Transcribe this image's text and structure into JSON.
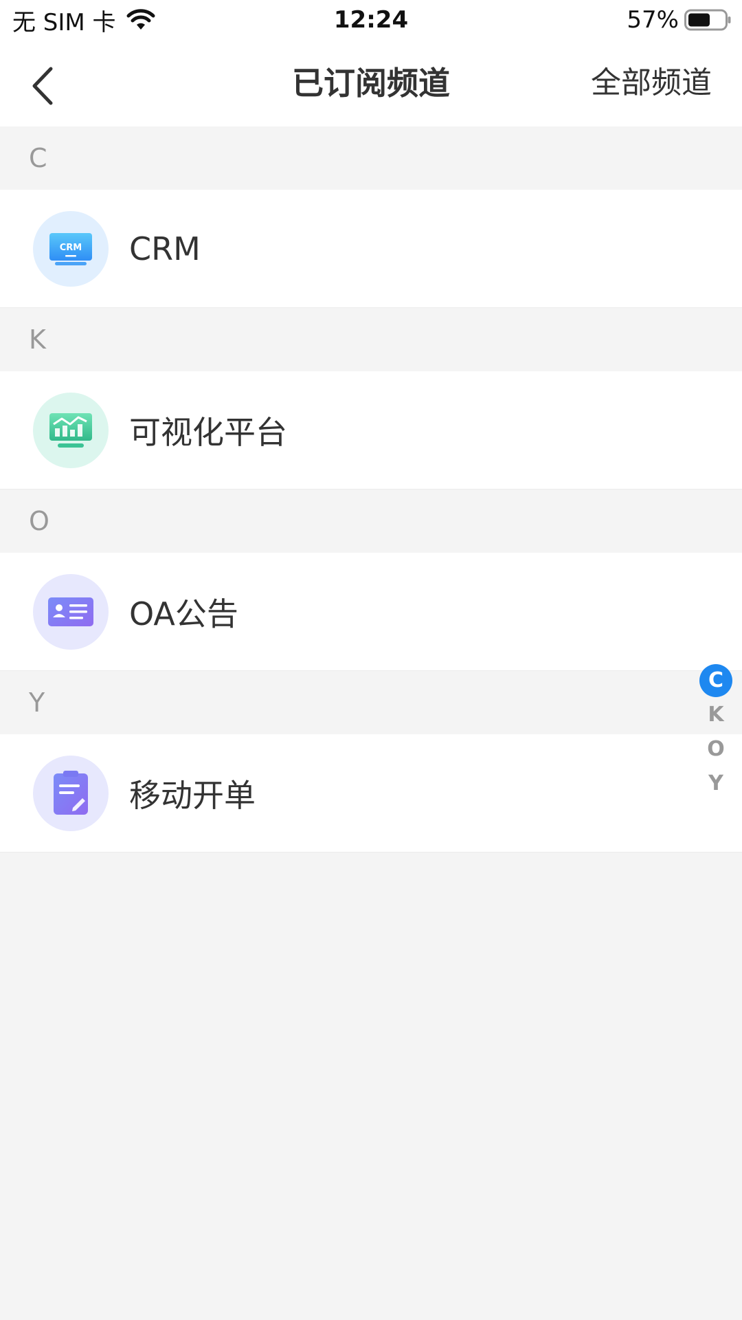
{
  "status_bar": {
    "carrier": "无 SIM 卡",
    "time": "12:24",
    "battery": "57%"
  },
  "nav": {
    "title": "已订阅频道",
    "right_action": "全部频道"
  },
  "sections": [
    {
      "letter": "C",
      "items": [
        {
          "label": "CRM",
          "icon": "crm-monitor-icon"
        }
      ]
    },
    {
      "letter": "K",
      "items": [
        {
          "label": "可视化平台",
          "icon": "chart-monitor-icon"
        }
      ]
    },
    {
      "letter": "O",
      "items": [
        {
          "label": "OA公告",
          "icon": "id-card-icon"
        }
      ]
    },
    {
      "letter": "Y",
      "items": [
        {
          "label": "移动开单",
          "icon": "clipboard-edit-icon"
        }
      ]
    }
  ],
  "index_bar": {
    "letters": [
      "C",
      "K",
      "O",
      "Y"
    ],
    "active": "C"
  },
  "colors": {
    "accent": "#1e88f0",
    "background": "#f4f4f4"
  }
}
